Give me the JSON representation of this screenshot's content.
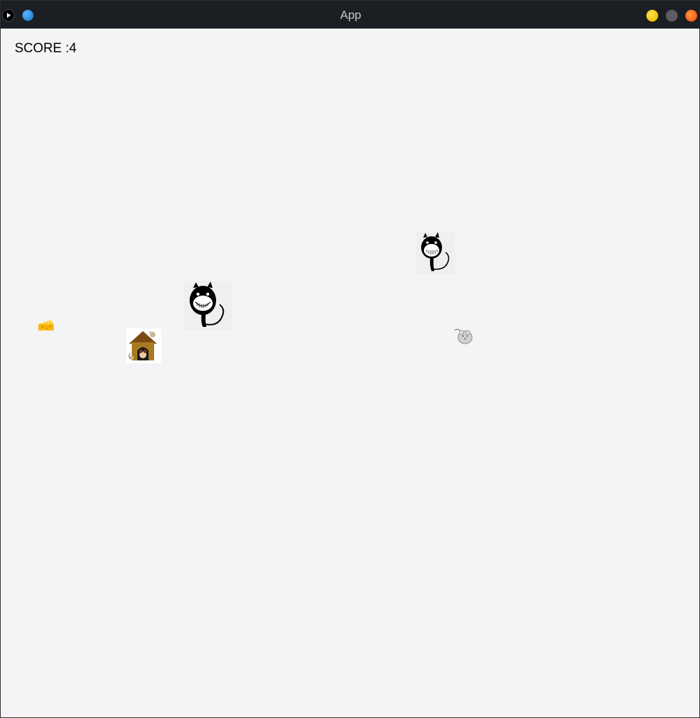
{
  "window": {
    "title": "App",
    "accent_colors": {
      "minimize": "#f2bd00",
      "maximize": "#5b5d63",
      "close": "#ef5a1e"
    }
  },
  "titlebar": {
    "icons": [
      "app-play-icon",
      "app-blue-dot-icon",
      "minimize-icon",
      "maximize-icon",
      "close-icon"
    ]
  },
  "game": {
    "score_text": "SCORE :4",
    "sprites": [
      "cat-sprite",
      "cat-sprite",
      "cheese-sprite",
      "mouse-house-sprite",
      "mouse-sprite"
    ]
  }
}
